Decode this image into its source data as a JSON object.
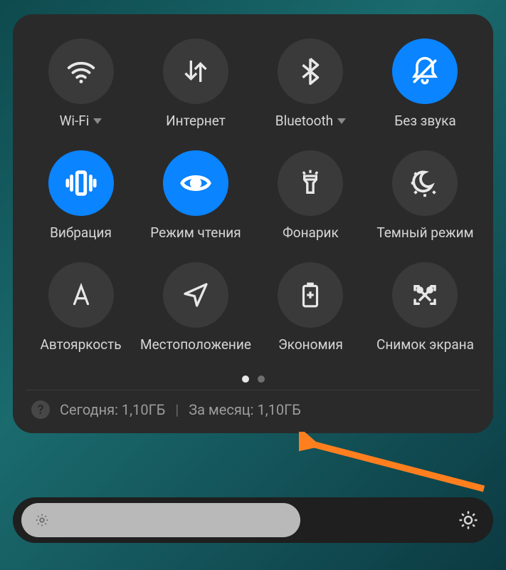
{
  "tiles": [
    {
      "id": "wifi",
      "label": "Wi-Fi",
      "active": false,
      "hasDropdown": true
    },
    {
      "id": "internet",
      "label": "Интернет",
      "active": false,
      "hasDropdown": false
    },
    {
      "id": "bluetooth",
      "label": "Bluetooth",
      "active": false,
      "hasDropdown": true
    },
    {
      "id": "mute",
      "label": "Без звука",
      "active": true,
      "hasDropdown": false
    },
    {
      "id": "vibration",
      "label": "Вибрация",
      "active": true,
      "hasDropdown": false
    },
    {
      "id": "reading",
      "label": "Режим чтения",
      "active": true,
      "hasDropdown": false
    },
    {
      "id": "flashlight",
      "label": "Фонарик",
      "active": false,
      "hasDropdown": false
    },
    {
      "id": "dark-mode",
      "label": "Темный режим",
      "active": false,
      "hasDropdown": false
    },
    {
      "id": "auto-bright",
      "label": "Автояркость",
      "active": false,
      "hasDropdown": false
    },
    {
      "id": "location",
      "label": "Местоположение",
      "active": false,
      "hasDropdown": false
    },
    {
      "id": "battery",
      "label": "Экономия",
      "active": false,
      "hasDropdown": false
    },
    {
      "id": "screenshot",
      "label": "Снимок экрана",
      "active": false,
      "hasDropdown": false
    }
  ],
  "pager": {
    "pages": 2,
    "active": 0
  },
  "usage": {
    "help": "?",
    "today_label": "Сегодня:",
    "today_value": "1,10ГБ",
    "month_label": "За месяц:",
    "month_value": "1,10ГБ"
  },
  "brightness": {
    "percent": 58
  },
  "colors": {
    "accent": "#0a84ff",
    "panel": "#2a2a2a",
    "arrow": "#ff7f1f"
  }
}
